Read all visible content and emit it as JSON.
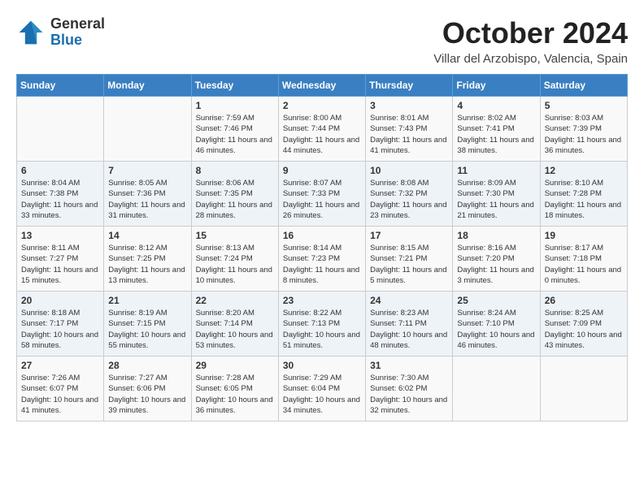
{
  "logo": {
    "general": "General",
    "blue": "Blue"
  },
  "title": "October 2024",
  "location": "Villar del Arzobispo, Valencia, Spain",
  "days_of_week": [
    "Sunday",
    "Monday",
    "Tuesday",
    "Wednesday",
    "Thursday",
    "Friday",
    "Saturday"
  ],
  "weeks": [
    [
      {
        "day": "",
        "text": ""
      },
      {
        "day": "",
        "text": ""
      },
      {
        "day": "1",
        "text": "Sunrise: 7:59 AM\nSunset: 7:46 PM\nDaylight: 11 hours and 46 minutes."
      },
      {
        "day": "2",
        "text": "Sunrise: 8:00 AM\nSunset: 7:44 PM\nDaylight: 11 hours and 44 minutes."
      },
      {
        "day": "3",
        "text": "Sunrise: 8:01 AM\nSunset: 7:43 PM\nDaylight: 11 hours and 41 minutes."
      },
      {
        "day": "4",
        "text": "Sunrise: 8:02 AM\nSunset: 7:41 PM\nDaylight: 11 hours and 38 minutes."
      },
      {
        "day": "5",
        "text": "Sunrise: 8:03 AM\nSunset: 7:39 PM\nDaylight: 11 hours and 36 minutes."
      }
    ],
    [
      {
        "day": "6",
        "text": "Sunrise: 8:04 AM\nSunset: 7:38 PM\nDaylight: 11 hours and 33 minutes."
      },
      {
        "day": "7",
        "text": "Sunrise: 8:05 AM\nSunset: 7:36 PM\nDaylight: 11 hours and 31 minutes."
      },
      {
        "day": "8",
        "text": "Sunrise: 8:06 AM\nSunset: 7:35 PM\nDaylight: 11 hours and 28 minutes."
      },
      {
        "day": "9",
        "text": "Sunrise: 8:07 AM\nSunset: 7:33 PM\nDaylight: 11 hours and 26 minutes."
      },
      {
        "day": "10",
        "text": "Sunrise: 8:08 AM\nSunset: 7:32 PM\nDaylight: 11 hours and 23 minutes."
      },
      {
        "day": "11",
        "text": "Sunrise: 8:09 AM\nSunset: 7:30 PM\nDaylight: 11 hours and 21 minutes."
      },
      {
        "day": "12",
        "text": "Sunrise: 8:10 AM\nSunset: 7:28 PM\nDaylight: 11 hours and 18 minutes."
      }
    ],
    [
      {
        "day": "13",
        "text": "Sunrise: 8:11 AM\nSunset: 7:27 PM\nDaylight: 11 hours and 15 minutes."
      },
      {
        "day": "14",
        "text": "Sunrise: 8:12 AM\nSunset: 7:25 PM\nDaylight: 11 hours and 13 minutes."
      },
      {
        "day": "15",
        "text": "Sunrise: 8:13 AM\nSunset: 7:24 PM\nDaylight: 11 hours and 10 minutes."
      },
      {
        "day": "16",
        "text": "Sunrise: 8:14 AM\nSunset: 7:23 PM\nDaylight: 11 hours and 8 minutes."
      },
      {
        "day": "17",
        "text": "Sunrise: 8:15 AM\nSunset: 7:21 PM\nDaylight: 11 hours and 5 minutes."
      },
      {
        "day": "18",
        "text": "Sunrise: 8:16 AM\nSunset: 7:20 PM\nDaylight: 11 hours and 3 minutes."
      },
      {
        "day": "19",
        "text": "Sunrise: 8:17 AM\nSunset: 7:18 PM\nDaylight: 11 hours and 0 minutes."
      }
    ],
    [
      {
        "day": "20",
        "text": "Sunrise: 8:18 AM\nSunset: 7:17 PM\nDaylight: 10 hours and 58 minutes."
      },
      {
        "day": "21",
        "text": "Sunrise: 8:19 AM\nSunset: 7:15 PM\nDaylight: 10 hours and 55 minutes."
      },
      {
        "day": "22",
        "text": "Sunrise: 8:20 AM\nSunset: 7:14 PM\nDaylight: 10 hours and 53 minutes."
      },
      {
        "day": "23",
        "text": "Sunrise: 8:22 AM\nSunset: 7:13 PM\nDaylight: 10 hours and 51 minutes."
      },
      {
        "day": "24",
        "text": "Sunrise: 8:23 AM\nSunset: 7:11 PM\nDaylight: 10 hours and 48 minutes."
      },
      {
        "day": "25",
        "text": "Sunrise: 8:24 AM\nSunset: 7:10 PM\nDaylight: 10 hours and 46 minutes."
      },
      {
        "day": "26",
        "text": "Sunrise: 8:25 AM\nSunset: 7:09 PM\nDaylight: 10 hours and 43 minutes."
      }
    ],
    [
      {
        "day": "27",
        "text": "Sunrise: 7:26 AM\nSunset: 6:07 PM\nDaylight: 10 hours and 41 minutes."
      },
      {
        "day": "28",
        "text": "Sunrise: 7:27 AM\nSunset: 6:06 PM\nDaylight: 10 hours and 39 minutes."
      },
      {
        "day": "29",
        "text": "Sunrise: 7:28 AM\nSunset: 6:05 PM\nDaylight: 10 hours and 36 minutes."
      },
      {
        "day": "30",
        "text": "Sunrise: 7:29 AM\nSunset: 6:04 PM\nDaylight: 10 hours and 34 minutes."
      },
      {
        "day": "31",
        "text": "Sunrise: 7:30 AM\nSunset: 6:02 PM\nDaylight: 10 hours and 32 minutes."
      },
      {
        "day": "",
        "text": ""
      },
      {
        "day": "",
        "text": ""
      }
    ]
  ]
}
